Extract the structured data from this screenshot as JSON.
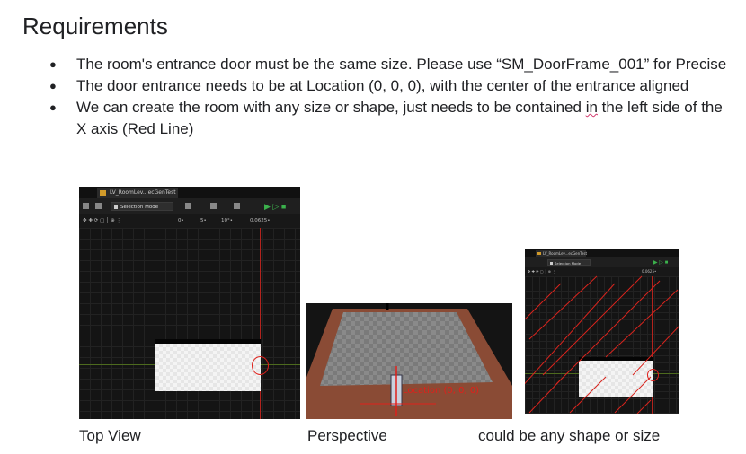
{
  "title": "Requirements",
  "requirements": [
    {
      "text": "The room's entrance door must be the same size. Please use “SM_DoorFrame_001” for Precise"
    },
    {
      "text": "The door entrance needs to be at Location (0, 0, 0), with the center of the entrance aligned"
    },
    {
      "text_before": "We can create the room with any size or shape, just needs to be contained ",
      "squiggle": "in",
      "text_after": " the left side of the X axis (Red Line)"
    }
  ],
  "editor": {
    "tab_title": "LV_RoomLev...ecGenTest",
    "tab_title_small": "LV_RoomLev...ecGenTest",
    "selection_mode": "Selection Mode",
    "viewbar": {
      "a": "0•",
      "b": "5•",
      "c": "10°•",
      "d": "0.0625•"
    }
  },
  "perspective_label_overlay": "Location (0, 0, 0)",
  "captions": {
    "top_view": "Top View",
    "perspective": "Perspective",
    "any_shape": "could be any shape or size"
  },
  "colors": {
    "axis_red": "#e0201b",
    "axis_green": "#4d6a1e",
    "brick": "#8a4b35",
    "floor": "#7d7d7d"
  }
}
